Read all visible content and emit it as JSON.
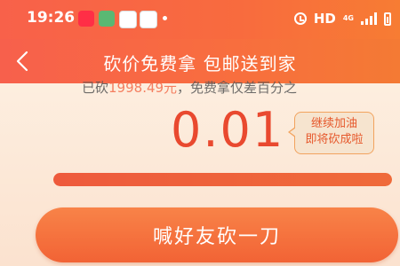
{
  "status_bar": {
    "time": "19:26",
    "hd": "HD",
    "net_top": "4G",
    "net_bottom": "ıl"
  },
  "nav": {
    "title": "砍价免费拿 包邮送到家"
  },
  "progress_info": {
    "prefix": "已砍",
    "amount": "1998.49元",
    "suffix": "，免费拿仅差百分之"
  },
  "price": "0.01",
  "tip": {
    "line1": "继续加油",
    "line2": "即将砍成啦"
  },
  "progress": {
    "value": 0.9999
  },
  "cta": {
    "label": "喊好友砍一刀"
  },
  "colors": {
    "header": "#f8614a",
    "accent": "#e9492f",
    "button": "#f26335",
    "background": "#fbe3cf"
  }
}
